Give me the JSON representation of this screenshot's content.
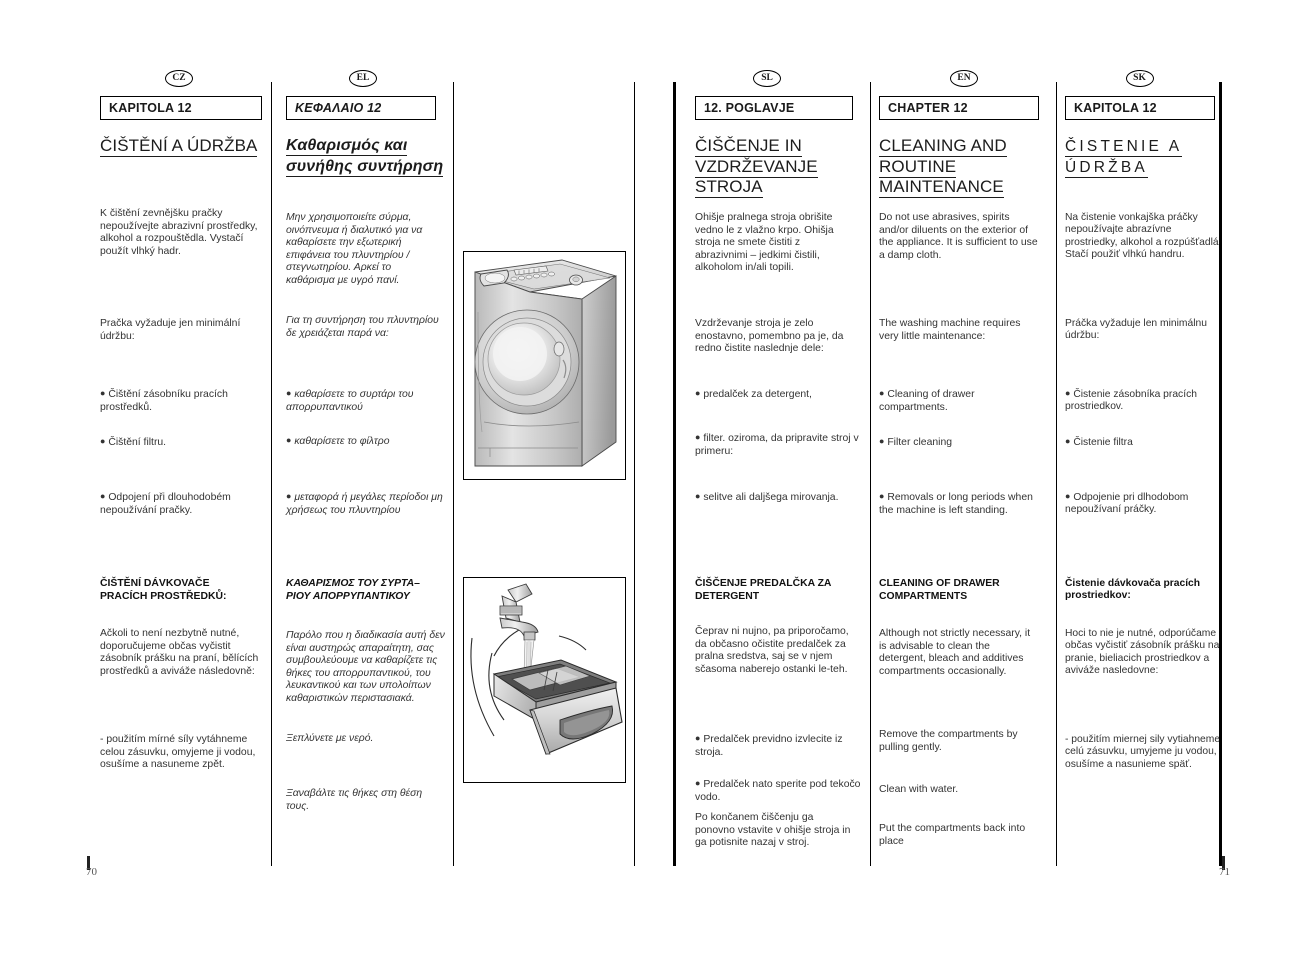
{
  "document": {
    "type": "washing-machine-user-manual",
    "left_page_number": "70",
    "right_page_number": "71"
  },
  "columns": [
    {
      "id": "cz",
      "lang_badge": "CZ",
      "chapter_label": "KAPITOLA 12",
      "title": "ČIŠTĚNÍ A ÚDRŽBA",
      "intro": "K čištění zevnějšku pračky nepoužívejte abrazivní prostředky, alkohol a rozpouštědla. Vystačí použít vlhký hadr.",
      "maintenance_lead": "Pračka vyžaduje jen minimální údržbu:",
      "bullets": [
        "Čištění zásobníku  pracích prostředků.",
        "Čištění filtru.",
        "Odpojení při dlouhodobém nepoužívání pračky."
      ],
      "section_heading": "ČIŠTĚNÍ DÁVKOVAČE\nPRACÍCH PROSTŘEDKŮ:",
      "section_body": "Ačkoli to není nezbytně nutné, doporučujeme občas vyčistit\nzásobník  prášku na praní, bělících prostředků a aviváže následovně:",
      "section_steps": [
        "- použitím mírné síly vytáhneme celou zásuvku, omyjeme ji vodou, osušíme a nasuneme zpět."
      ]
    },
    {
      "id": "el",
      "lang_badge": "EL",
      "chapter_label": "ΚΕΦΑΛΑΙΟ 12",
      "title": "Καθαρισμός και συνήθης συντήρηση",
      "intro": "Μην χρησιμοποιείτε σύρμα, οινόπνευμα ή διαλυτικό για να καθαρίσετε την εξωτερική επιφάνεια του πλυντηρίου / στεγνωτηρίου. Αρκεί το καθάρισμα με υγρό πανί.",
      "maintenance_lead": "Για τη συντήρηση του πλυντηρίου δε χρειάζεται παρά να:",
      "bullets": [
        "καθαρίσετε το συρτάρι του απορρυπαντικού",
        "καθαρίσετε το φίλτρο",
        "μεταφορά ή μεγάλες περίοδοι μη χρήσεως του πλυντηρίου"
      ],
      "section_heading": "ΚΑΘΑΡΙΣΜΟΣ ΤΟΥ ΣΥΡΤΑ–\nΡΙΟΥ ΑΠΟΡΡΥΠΑΝΤΙΚΟΥ",
      "section_body": "Παρόλο που η διαδικασία αυτή δεν είναι αυστηρώς απαραίτητη, σας συμβουλεύουμε να καθαρίζετε τις θήκες του απορρυπαντικού, του λευκαντικού και των υπολοίπων καθαριστικών περιστασιακά.",
      "section_steps": [
        "Ξεπλύνετε με νερό.",
        "Ξαναβάλτε τις θήκες στη θέση τους."
      ]
    },
    {
      "id": "sl",
      "lang_badge": "SL",
      "chapter_label": "12. POGLAVJE",
      "title": "ČIŠČENJE IN VZDRŽEVANJE STROJA",
      "intro": "Ohišje pralnega stroja obrišite vedno le z vlažno krpo. Ohišja stroja ne smete čistiti z abrazivnimi – jedkimi čistili, alkoholom in/ali topili.",
      "maintenance_lead": "Vzdrževanje stroja je zelo enostavno, pomembno pa je, da redno čistite naslednje dele:",
      "bullets": [
        "predalček za detergent,",
        "filter. oziroma, da pripravite stroj v primeru:",
        "selitve ali daljšega mirovanja."
      ],
      "section_heading": "ČIŠČENJE PREDALČKA ZA\nDETERGENT",
      "section_body": "Čeprav ni nujno, pa priporočamo, da občasno očistite predalček za pralna sredstva, saj se v njem sčasoma naberejo ostanki le-teh.",
      "section_bullets": [
        "Predalček previdno izvlecite iz stroja.",
        "Predalček nato sperite pod tekočo vodo."
      ],
      "section_steps": [
        "Po končanem čiščenju ga ponovno vstavite v ohišje stroja in ga potisnite nazaj v stroj."
      ]
    },
    {
      "id": "en",
      "lang_badge": "EN",
      "chapter_label": "CHAPTER 12",
      "title": "CLEANING AND ROUTINE MAINTENANCE",
      "intro": "Do not use abrasives, spirits and/or diluents on the exterior of the appliance. It is sufficient to use a damp cloth.",
      "maintenance_lead": "The washing machine requires very little maintenance:",
      "bullets": [
        "Cleaning of drawer compartments.",
        "Filter cleaning",
        "Removals or long periods when the machine is left standing."
      ],
      "section_heading": "CLEANING OF DRAWER\nCOMPARTMENTS",
      "section_body": "Although not strictly necessary, it is advisable to clean the detergent, bleach and additives compartments occasionally.",
      "section_steps": [
        "Remove the compartments by pulling gently.",
        "Clean with water.",
        "Put the compartments back into place"
      ]
    },
    {
      "id": "sk",
      "lang_badge": "SK",
      "chapter_label": "KAPITOLA 12",
      "title": "ČISTENIE A ÚDRŽBA",
      "intro": "Na čistenie vonkajška práčky nepoužívajte abrazívne prostriedky, alkohol a rozpúšťadlá. Stačí použiť vlhkú handru.",
      "maintenance_lead": "Práčka vyžaduje len minimálnu údržbu:",
      "bullets": [
        "Čistenie zásobníka pracích prostriedkov.",
        "Čistenie filtra",
        "Odpojenie pri dlhodobom nepoužívaní práčky."
      ],
      "section_heading": "Čistenie dávkovača pracích\nprostriedkov:",
      "section_body": "Hoci to nie je nutné, odporúčame občas vyčistiť zásobník prášku na pranie, bieliacich prostriedkov a aviváže nasledovne:",
      "section_steps": [
        "- použitím miernej sily vytiahneme celú zásuvku, umyjeme ju vodou, osušíme a nasunieme späť."
      ]
    }
  ],
  "illustrations": [
    {
      "name": "washing-machine-front-view",
      "caption": ""
    },
    {
      "name": "detergent-drawer-rinsing-under-tap",
      "caption": ""
    }
  ],
  "colors": {
    "ink": "#1a1a1a",
    "body_text": "#333333",
    "rule": "#000000",
    "page_number": "#555555"
  }
}
